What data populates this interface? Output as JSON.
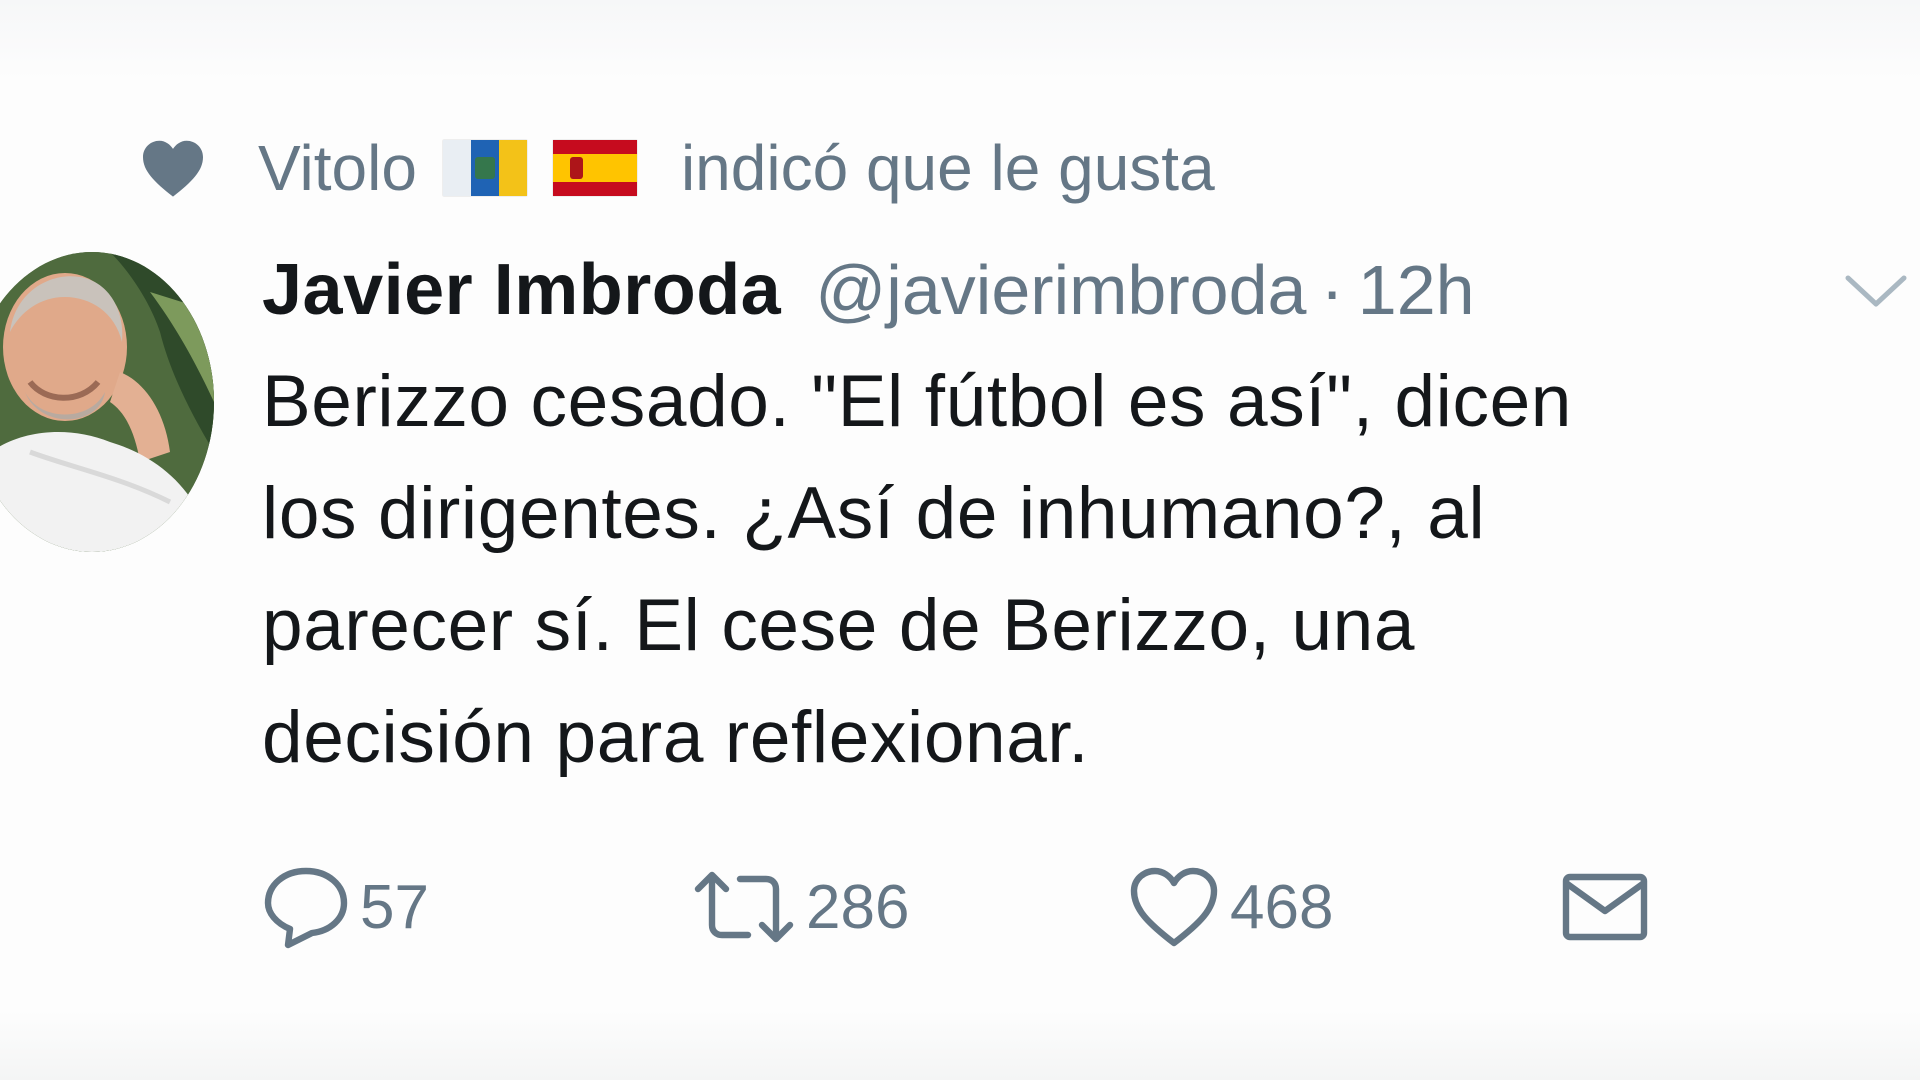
{
  "context": {
    "icon": "heart-icon",
    "name": "Vitolo",
    "flags": [
      "flag-canary-islands",
      "flag-spain"
    ],
    "text": "indicó que le gusta"
  },
  "tweet": {
    "display_name": "Javier Imbroda",
    "handle": "@javierimbroda",
    "separator": "·",
    "time": "12h",
    "text_lines": [
      "Berizzo cesado. \"El fútbol es así\", dicen",
      "los dirigentes. ¿Así de inhumano?, al",
      "parecer sí. El cese de Berizzo, una",
      "decisión para reflexionar."
    ]
  },
  "actions": {
    "reply": {
      "icon": "reply-icon",
      "count": "57"
    },
    "retweet": {
      "icon": "retweet-icon",
      "count": "286"
    },
    "like": {
      "icon": "heart-outline-icon",
      "count": "468"
    },
    "dm": {
      "icon": "envelope-icon"
    }
  },
  "colors": {
    "text_primary": "#14171a",
    "text_secondary": "#657786",
    "background": "#fdfdfd"
  }
}
